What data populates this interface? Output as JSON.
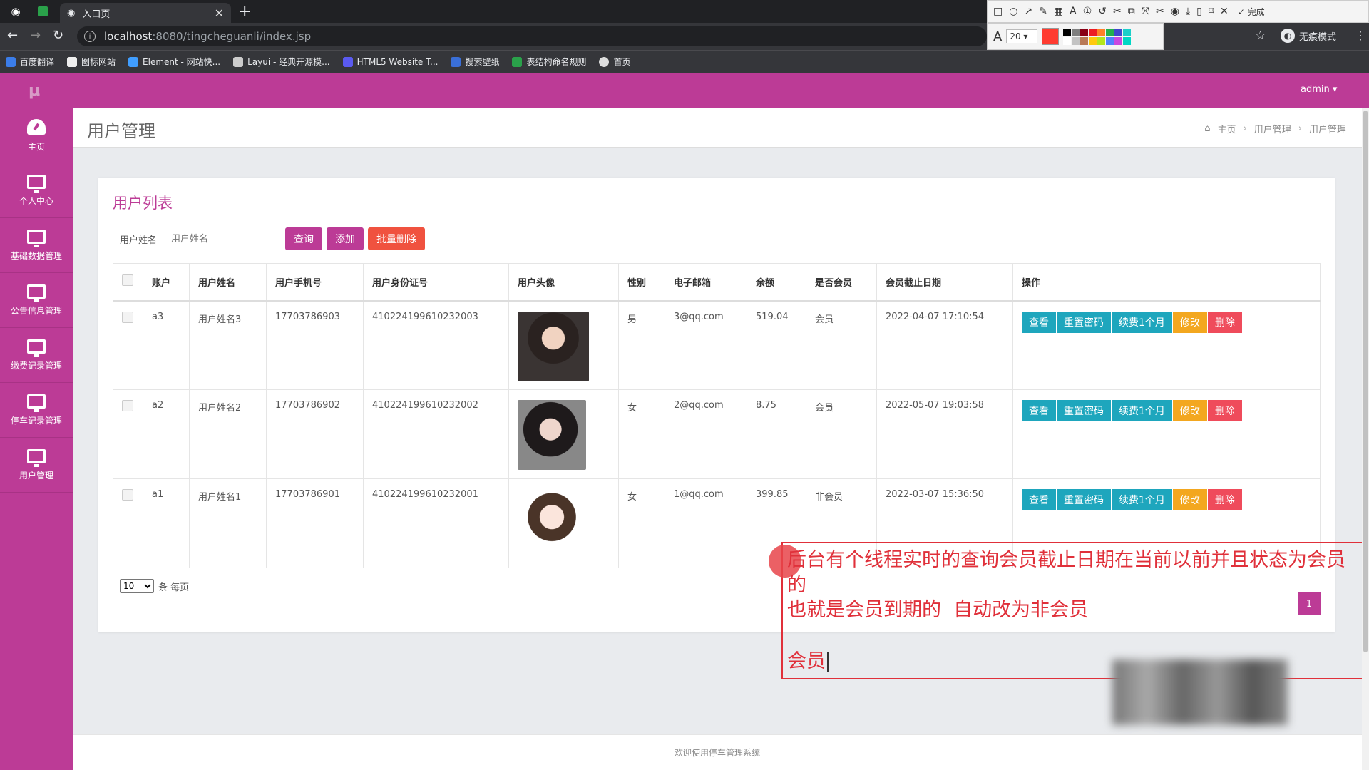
{
  "browser": {
    "tab_title": "入口页",
    "url_host": "localhost",
    "url_path": ":8080/tingcheguanli/index.jsp",
    "incognito_label": "无痕模式",
    "bookmarks": [
      "百度翻译",
      "图标网站",
      "Element - 网站快...",
      "Layui - 经典开源模...",
      "HTML5 Website T...",
      "搜索壁纸",
      "表结构命名规则",
      "首页"
    ]
  },
  "snip_toolbar": {
    "done_label": "完成",
    "font_size": "20",
    "palette": [
      "#000000",
      "#7f7f7f",
      "#880015",
      "#ed1c24",
      "#ff7f27",
      "#22b14c",
      "#3f48cc",
      "#1ccfc9",
      "#ffffff",
      "#c3c3c3",
      "#b97a57",
      "#ffc90e",
      "#b5e61d",
      "#4f81ff",
      "#c848e0",
      "#00d7c5"
    ]
  },
  "app": {
    "logo": "μ",
    "user_menu": "admin ▾",
    "accent_color": "#bc3b96",
    "sidebar": [
      {
        "label": "主页",
        "icon": "dashboard-icon"
      },
      {
        "label": "个人中心",
        "icon": "monitor-icon"
      },
      {
        "label": "基础数据管理",
        "icon": "monitor-icon"
      },
      {
        "label": "公告信息管理",
        "icon": "monitor-icon"
      },
      {
        "label": "缴费记录管理",
        "icon": "monitor-icon"
      },
      {
        "label": "停车记录管理",
        "icon": "monitor-icon"
      },
      {
        "label": "用户管理",
        "icon": "monitor-icon"
      }
    ],
    "page_title": "用户管理",
    "breadcrumb": [
      "主页",
      "用户管理",
      "用户管理"
    ],
    "panel_title": "用户列表",
    "search": {
      "label": "用户姓名",
      "placeholder": "用户姓名"
    },
    "buttons": {
      "query": "查询",
      "add": "添加",
      "batch_delete": "批量删除"
    },
    "columns": [
      "账户",
      "用户姓名",
      "用户手机号",
      "用户身份证号",
      "用户头像",
      "性别",
      "电子邮箱",
      "余额",
      "是否会员",
      "会员截止日期",
      "操作"
    ],
    "rows": [
      {
        "account": "a3",
        "name": "用户姓名3",
        "phone": "17703786903",
        "id_card": "410224199610232003",
        "gender": "男",
        "email": "3@qq.com",
        "balance": "519.04",
        "member": "会员",
        "expire": "2022-04-07 17:10:54"
      },
      {
        "account": "a2",
        "name": "用户姓名2",
        "phone": "17703786902",
        "id_card": "410224199610232002",
        "gender": "女",
        "email": "2@qq.com",
        "balance": "8.75",
        "member": "会员",
        "expire": "2022-05-07 19:03:58"
      },
      {
        "account": "a1",
        "name": "用户姓名1",
        "phone": "17703786901",
        "id_card": "410224199610232001",
        "gender": "女",
        "email": "1@qq.com",
        "balance": "399.85",
        "member": "非会员",
        "expire": "2022-03-07 15:36:50"
      }
    ],
    "row_actions": {
      "view": "查看",
      "reset": "重置密码",
      "renew": "续费1个月",
      "edit": "修改",
      "delete": "删除"
    },
    "pager": {
      "page_size": "10",
      "per_page_label": "条 每页",
      "current_page": "1"
    },
    "footer": "欢迎使用停车管理系统"
  },
  "annotation": {
    "text": "后台有个线程实时的查询会员截止日期在当前以前并且状态为会员的\n也就是会员到期的  自动改为非会员",
    "typing": "会员"
  }
}
